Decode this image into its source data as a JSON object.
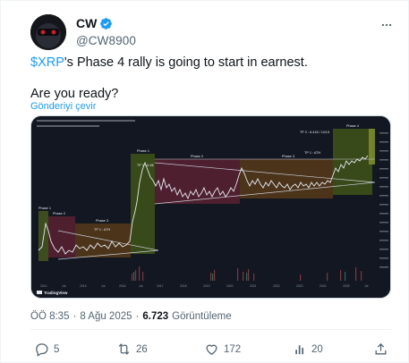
{
  "author": {
    "display_name": "CW",
    "handle": "@CW8900",
    "verified_color": "#1d9bf0"
  },
  "tweet": {
    "cashtag": "$XRP",
    "text_rest": "'s Phase 4 rally is going to start in earnest.",
    "text_line2": "Are you ready?",
    "translate_label": "Gönderiyi çevir"
  },
  "media": {
    "watermark": "TradingView",
    "phase_labels": [
      "Phase 1",
      "Phase 2",
      "Phase 3",
      "Phase 1",
      "Phase 2",
      "Phase 3",
      "Phase 4"
    ],
    "tp_labels": [
      "TP 1 : ATH",
      "TP 1 : ATH",
      "TP 1 : 6.4$",
      "TP 2 : 6.418 / 124.5"
    ],
    "x_ticks": [
      "2014",
      "Jul",
      "2015",
      "Jul",
      "2016",
      "Jul",
      "2017",
      "2018",
      "2019",
      "2020",
      "2021",
      "2022",
      "2023",
      "2024",
      "2025",
      "Jul"
    ]
  },
  "meta": {
    "time": "ÖÖ 8:35",
    "separator": "·",
    "date": "8 Ağu 2025",
    "views_count": "6.723",
    "views_label": "Görüntüleme"
  },
  "actions": {
    "replies": "5",
    "reposts": "26",
    "likes": "172",
    "bookmarks": "20"
  },
  "icons": [
    "more-icon",
    "verified-icon",
    "reply-icon",
    "repost-icon",
    "like-icon",
    "bookmark-icon",
    "share-icon"
  ]
}
